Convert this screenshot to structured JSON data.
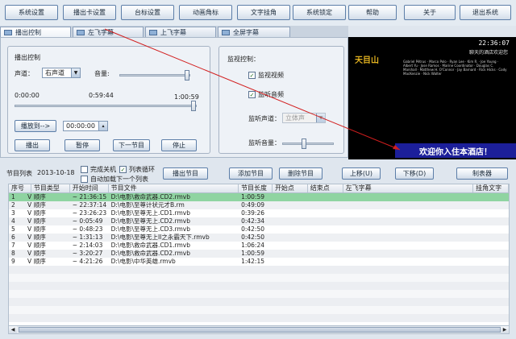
{
  "toolbar": [
    "系统设置",
    "播出卡设置",
    "台标设置",
    "动画角标",
    "文字挂角",
    "系统锁定",
    "帮助",
    "关于",
    "退出系统"
  ],
  "tabs": [
    "播出控制",
    "左飞字幕",
    "上飞字幕",
    "全屏字幕"
  ],
  "playback": {
    "group_title": "播出控制",
    "channel_label": "声道：",
    "channel_value": "右声道",
    "volume_label": "音量:",
    "time_start": "0:00:00",
    "time_current": "0:59:44",
    "time_total": "1:00:59",
    "play_at_button": "播放到-->",
    "play_at_time": "00:00:00",
    "buttons": [
      "播出",
      "暂停",
      "下一节目",
      "停止"
    ]
  },
  "monitor": {
    "group_title": "监视控制：",
    "monitor_video": "监视视频",
    "monitor_audio": "监听音频",
    "channel_label": "监听声道：",
    "channel_value": "立体声",
    "volume_label": "监听音量："
  },
  "preview": {
    "logo": "天目山",
    "clock": "22:36:07",
    "subtitle": "聊天的酒店欢迎您",
    "credits": "Gabriel Pétrus · Marco Polo · Ryan Lee · Kim R. · Joe Young · Albert Yu · Jose Ramos · Marine Coordinator · Douglas C. Marshall · Matthew H. O'Connor · Jay Barnard · Rick Hicks · Cody MacKenzie · Nick Walter",
    "banner": "欢迎你入住本酒店！"
  },
  "list_controls": {
    "label": "节目列表",
    "date": "2013-10-18",
    "chk_shutdown": "完成关机",
    "chk_loop": "列表循环",
    "chk_autoload": "自动加载下一个列表",
    "buttons": [
      "播出节目",
      "添加节目",
      "删除节目",
      "上移(U)",
      "下移(D)",
      "制表器"
    ]
  },
  "columns": [
    "序号",
    "节目类型",
    "开始时间",
    "节目文件",
    "节目长度",
    "开始点",
    "结束点",
    "左飞字幕",
    "挂角文字"
  ],
  "rows": [
    [
      "1",
      "V",
      "顺序",
      "~ 21:36:15",
      "D:\\电影\\救命武器.CD2.rmvb",
      "1:00:59",
      "",
      "",
      "",
      ""
    ],
    [
      "2",
      "V",
      "顺序",
      "~ 22:37:14",
      "D:\\电影\\至尊计状元才B.rm",
      "0:49:09",
      "",
      "",
      "",
      ""
    ],
    [
      "3",
      "V",
      "顺序",
      "~ 23:26:23",
      "D:\\电影\\至尊无上.CD1.rmvb",
      "0:39:26",
      "",
      "",
      "",
      ""
    ],
    [
      "4",
      "V",
      "顺序",
      "~ 0:05:49",
      "D:\\电影\\至尊无上.CD2.rmvb",
      "0:42:34",
      "",
      "",
      "",
      ""
    ],
    [
      "5",
      "V",
      "顺序",
      "~ 0:48:23",
      "D:\\电影\\至尊无上.CD3.rmvb",
      "0:42:50",
      "",
      "",
      "",
      ""
    ],
    [
      "6",
      "V",
      "顺序",
      "~ 1:31:13",
      "D:\\电影\\至尊无上II之永霸天下.rmvb",
      "0:42:50",
      "",
      "",
      "",
      ""
    ],
    [
      "7",
      "V",
      "顺序",
      "~ 2:14:03",
      "D:\\电影\\救命武器.CD1.rmvb",
      "1:06:24",
      "",
      "",
      "",
      ""
    ],
    [
      "8",
      "V",
      "顺序",
      "~ 3:20:27",
      "D:\\电影\\救命武器.CD2.rmvb",
      "1:00:59",
      "",
      "",
      "",
      ""
    ],
    [
      "9",
      "V",
      "顺序",
      "~ 4:21:26",
      "D:\\电影\\中华英雄.rmvb",
      "1:42:15",
      "",
      "",
      "",
      ""
    ]
  ]
}
